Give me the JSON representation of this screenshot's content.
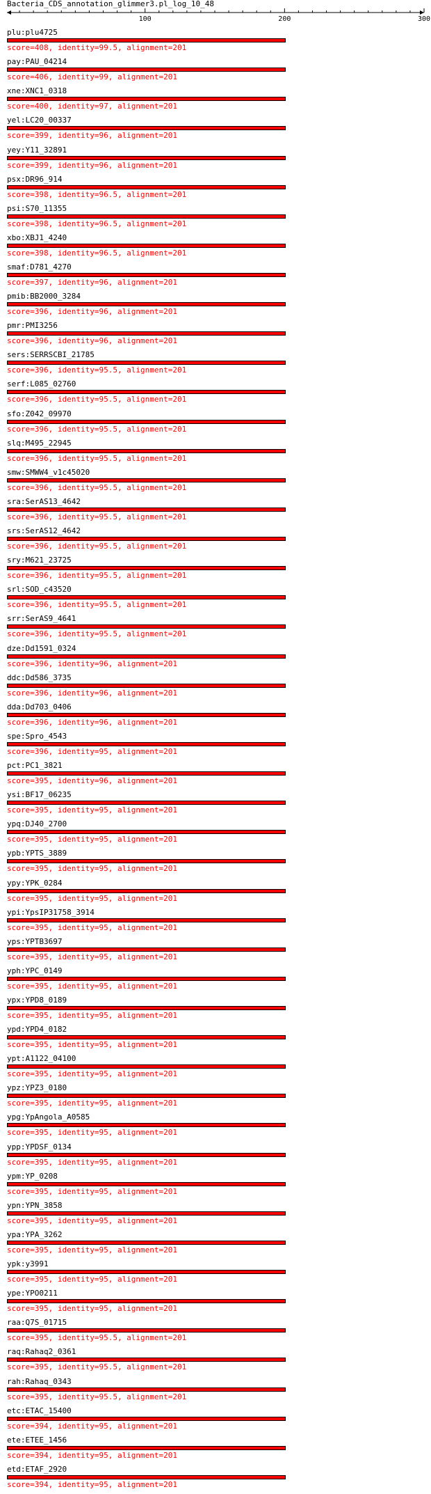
{
  "title": "Bacteria_CDS_annotation_glimmer3.pl_log_10_48",
  "colors": {
    "bar": "#ff0000",
    "bar_border": "#000000",
    "score_text": "#ff0000",
    "name_text": "#000000"
  },
  "ruler": {
    "min": 1,
    "max": 300,
    "major_ticks": [
      100,
      200,
      300
    ]
  },
  "hits": [
    {
      "name": "plu:plu4725",
      "score": "score=408, identity=99.5, alignment=201",
      "start": 1,
      "end": 201
    },
    {
      "name": "pay:PAU_04214",
      "score": "score=406, identity=99, alignment=201",
      "start": 1,
      "end": 201
    },
    {
      "name": "xne:XNC1_0318",
      "score": "score=400, identity=97, alignment=201",
      "start": 1,
      "end": 201
    },
    {
      "name": "yel:LC20_00337",
      "score": "score=399, identity=96, alignment=201",
      "start": 1,
      "end": 201
    },
    {
      "name": "yey:Y11_32891",
      "score": "score=399, identity=96, alignment=201",
      "start": 1,
      "end": 201
    },
    {
      "name": "psx:DR96_914",
      "score": "score=398, identity=96.5, alignment=201",
      "start": 1,
      "end": 201
    },
    {
      "name": "psi:S70_11355",
      "score": "score=398, identity=96.5, alignment=201",
      "start": 1,
      "end": 201
    },
    {
      "name": "xbo:XBJ1_4240",
      "score": "score=398, identity=96.5, alignment=201",
      "start": 1,
      "end": 201
    },
    {
      "name": "smaf:D781_4270",
      "score": "score=397, identity=96, alignment=201",
      "start": 1,
      "end": 201
    },
    {
      "name": "pmib:BB2000_3284",
      "score": "score=396, identity=96, alignment=201",
      "start": 1,
      "end": 201
    },
    {
      "name": "pmr:PMI3256",
      "score": "score=396, identity=96, alignment=201",
      "start": 1,
      "end": 201
    },
    {
      "name": "sers:SERRSCBI_21785",
      "score": "score=396, identity=95.5, alignment=201",
      "start": 1,
      "end": 201
    },
    {
      "name": "serf:L085_02760",
      "score": "score=396, identity=95.5, alignment=201",
      "start": 1,
      "end": 201
    },
    {
      "name": "sfo:Z042_09970",
      "score": "score=396, identity=95.5, alignment=201",
      "start": 1,
      "end": 201
    },
    {
      "name": "slq:M495_22945",
      "score": "score=396, identity=95.5, alignment=201",
      "start": 1,
      "end": 201
    },
    {
      "name": "smw:SMWW4_v1c45020",
      "score": "score=396, identity=95.5, alignment=201",
      "start": 1,
      "end": 201
    },
    {
      "name": "sra:SerAS13_4642",
      "score": "score=396, identity=95.5, alignment=201",
      "start": 1,
      "end": 201
    },
    {
      "name": "srs:SerAS12_4642",
      "score": "score=396, identity=95.5, alignment=201",
      "start": 1,
      "end": 201
    },
    {
      "name": "sry:M621_23725",
      "score": "score=396, identity=95.5, alignment=201",
      "start": 1,
      "end": 201
    },
    {
      "name": "srl:SOD_c43520",
      "score": "score=396, identity=95.5, alignment=201",
      "start": 1,
      "end": 201
    },
    {
      "name": "srr:SerAS9_4641",
      "score": "score=396, identity=95.5, alignment=201",
      "start": 1,
      "end": 201
    },
    {
      "name": "dze:Dd1591_0324",
      "score": "score=396, identity=96, alignment=201",
      "start": 1,
      "end": 201
    },
    {
      "name": "ddc:Dd586_3735",
      "score": "score=396, identity=96, alignment=201",
      "start": 1,
      "end": 201
    },
    {
      "name": "dda:Dd703_0406",
      "score": "score=396, identity=96, alignment=201",
      "start": 1,
      "end": 201
    },
    {
      "name": "spe:Spro_4543",
      "score": "score=396, identity=95, alignment=201",
      "start": 1,
      "end": 201
    },
    {
      "name": "pct:PC1_3821",
      "score": "score=395, identity=96, alignment=201",
      "start": 1,
      "end": 201
    },
    {
      "name": "ysi:BF17_06235",
      "score": "score=395, identity=95, alignment=201",
      "start": 1,
      "end": 201
    },
    {
      "name": "ypq:DJ40_2700",
      "score": "score=395, identity=95, alignment=201",
      "start": 1,
      "end": 201
    },
    {
      "name": "ypb:YPTS_3889",
      "score": "score=395, identity=95, alignment=201",
      "start": 1,
      "end": 201
    },
    {
      "name": "ypy:YPK_0284",
      "score": "score=395, identity=95, alignment=201",
      "start": 1,
      "end": 201
    },
    {
      "name": "ypi:YpsIP31758_3914",
      "score": "score=395, identity=95, alignment=201",
      "start": 1,
      "end": 201
    },
    {
      "name": "yps:YPTB3697",
      "score": "score=395, identity=95, alignment=201",
      "start": 1,
      "end": 201
    },
    {
      "name": "yph:YPC_0149",
      "score": "score=395, identity=95, alignment=201",
      "start": 1,
      "end": 201
    },
    {
      "name": "ypx:YPD8_0189",
      "score": "score=395, identity=95, alignment=201",
      "start": 1,
      "end": 201
    },
    {
      "name": "ypd:YPD4_0182",
      "score": "score=395, identity=95, alignment=201",
      "start": 1,
      "end": 201
    },
    {
      "name": "ypt:A1122_04100",
      "score": "score=395, identity=95, alignment=201",
      "start": 1,
      "end": 201
    },
    {
      "name": "ypz:YPZ3_0180",
      "score": "score=395, identity=95, alignment=201",
      "start": 1,
      "end": 201
    },
    {
      "name": "ypg:YpAngola_A0585",
      "score": "score=395, identity=95, alignment=201",
      "start": 1,
      "end": 201
    },
    {
      "name": "ypp:YPDSF_0134",
      "score": "score=395, identity=95, alignment=201",
      "start": 1,
      "end": 201
    },
    {
      "name": "ypm:YP_0208",
      "score": "score=395, identity=95, alignment=201",
      "start": 1,
      "end": 201
    },
    {
      "name": "ypn:YPN_3858",
      "score": "score=395, identity=95, alignment=201",
      "start": 1,
      "end": 201
    },
    {
      "name": "ypa:YPA_3262",
      "score": "score=395, identity=95, alignment=201",
      "start": 1,
      "end": 201
    },
    {
      "name": "ypk:y3991",
      "score": "score=395, identity=95, alignment=201",
      "start": 1,
      "end": 201
    },
    {
      "name": "ype:YPO0211",
      "score": "score=395, identity=95, alignment=201",
      "start": 1,
      "end": 201
    },
    {
      "name": "raa:Q7S_01715",
      "score": "score=395, identity=95.5, alignment=201",
      "start": 1,
      "end": 201
    },
    {
      "name": "raq:Rahaq2_0361",
      "score": "score=395, identity=95.5, alignment=201",
      "start": 1,
      "end": 201
    },
    {
      "name": "rah:Rahaq_0343",
      "score": "score=395, identity=95.5, alignment=201",
      "start": 1,
      "end": 201
    },
    {
      "name": "etc:ETAC_15400",
      "score": "score=394, identity=95, alignment=201",
      "start": 1,
      "end": 201
    },
    {
      "name": "ete:ETEE_1456",
      "score": "score=394, identity=95, alignment=201",
      "start": 1,
      "end": 201
    },
    {
      "name": "etd:ETAF_2920",
      "score": "score=394, identity=95, alignment=201",
      "start": 1,
      "end": 201
    }
  ]
}
